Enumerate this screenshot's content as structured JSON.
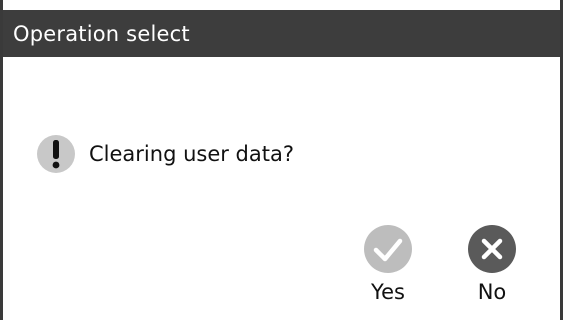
{
  "dialog": {
    "title": "Operation select",
    "message": "Clearing user data?",
    "icon": "warning-exclamation-icon",
    "buttons": {
      "yes_label": "Yes",
      "yes_icon": "checkmark-icon",
      "no_label": "No",
      "no_icon": "close-icon"
    }
  },
  "colors": {
    "titlebar_bg": "#3d3d3d",
    "title_text": "#ffffff",
    "yes_icon_bg": "#bdbdbd",
    "no_icon_bg": "#5a5a5a",
    "warning_icon_bg": "#c8c8c8"
  }
}
